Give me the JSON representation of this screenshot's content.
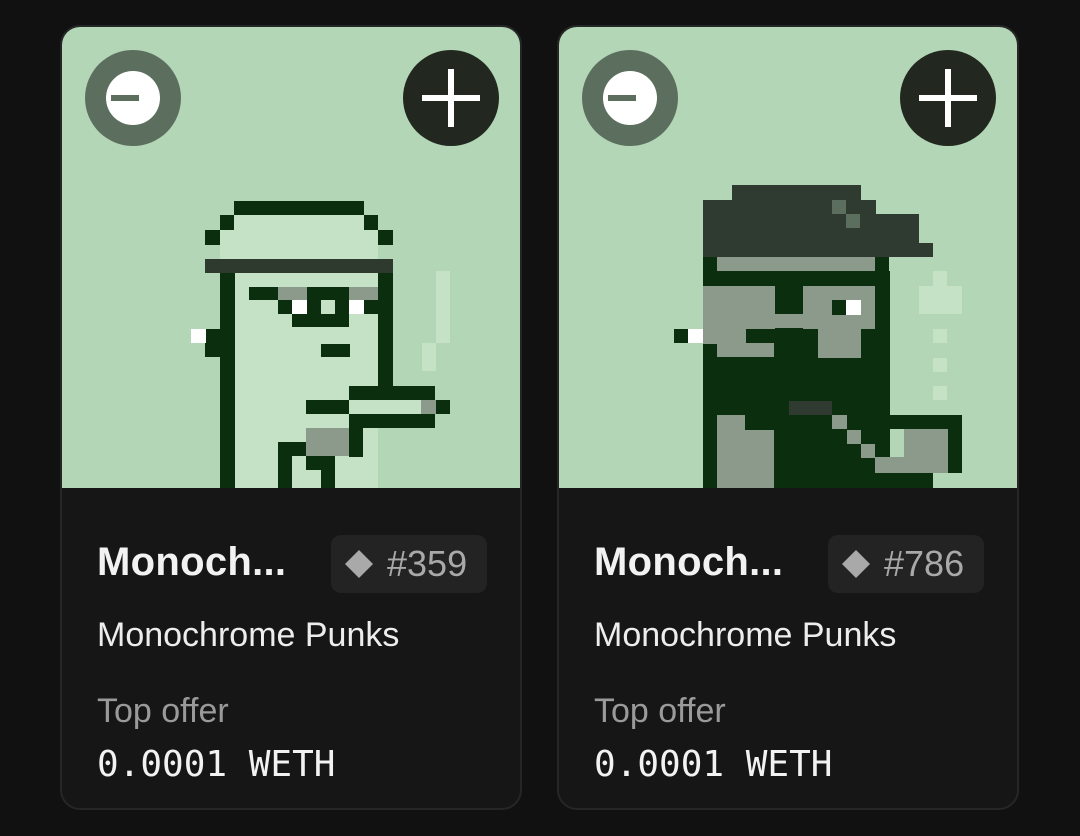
{
  "colors": {
    "page_background": "#111111",
    "card_background": "#161616",
    "artwork_background": "#b3d6b7",
    "pixel_dark": "#0b2e0f",
    "pixel_light": "#c5e2c7",
    "pixel_gray": "#8b9a8a"
  },
  "cards": [
    {
      "name": "Monoch...",
      "token_id": "#359",
      "collection": "Monochrome Punks",
      "top_offer_label": "Top offer",
      "top_offer_value": "0.0001 WETH",
      "icons": {
        "remove": "minus-circle-icon",
        "add": "plus-icon",
        "chain": "diamond-icon"
      }
    },
    {
      "name": "Monoch...",
      "token_id": "#786",
      "collection": "Monochrome Punks",
      "top_offer_label": "Top offer",
      "top_offer_value": "0.0001 WETH",
      "icons": {
        "remove": "minus-circle-icon",
        "add": "plus-icon",
        "chain": "diamond-icon"
      }
    }
  ]
}
